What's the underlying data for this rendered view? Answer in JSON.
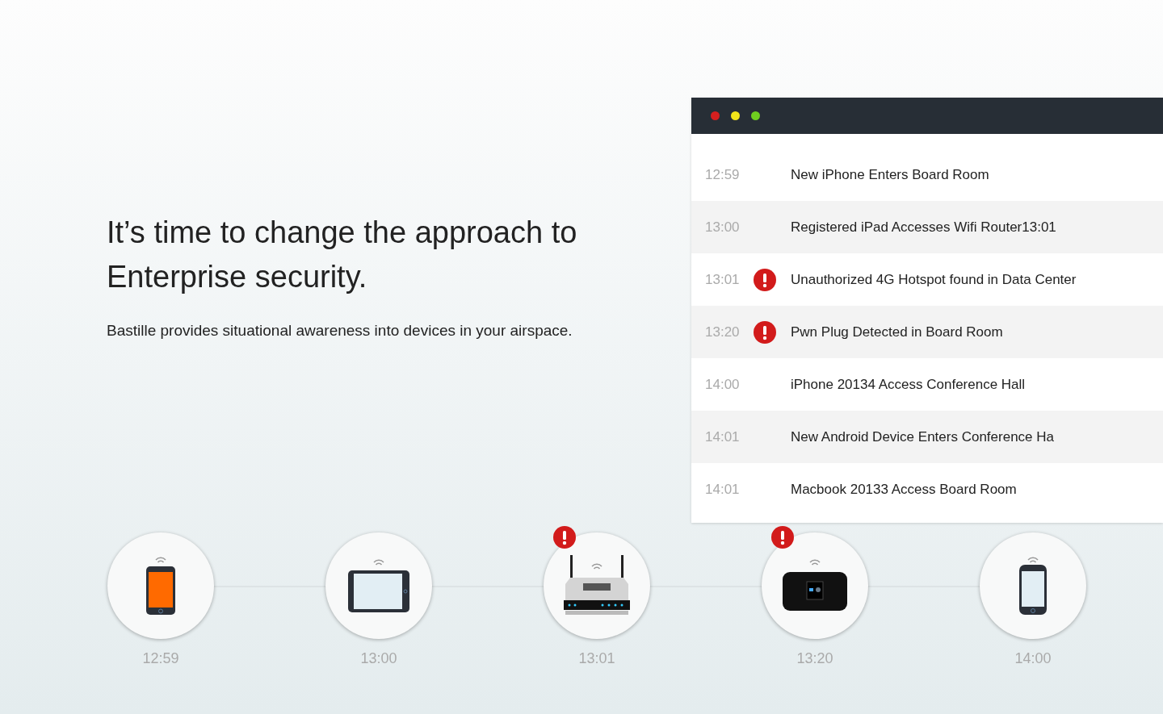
{
  "headline": "It’s time to change the approach to Enterprise security.",
  "subtitle": "Bastille provides situational awareness into devices in your airspace.",
  "window": {
    "controls": [
      {
        "color": "#d61f1f"
      },
      {
        "color": "#f2e51a"
      },
      {
        "color": "#6fcf1f"
      }
    ]
  },
  "events": [
    {
      "time": "12:59",
      "alert": false,
      "text": "New iPhone Enters Board Room"
    },
    {
      "time": "13:00",
      "alert": false,
      "text": "Registered iPad Accesses Wifi Router13:01"
    },
    {
      "time": "13:01",
      "alert": true,
      "text": "Unauthorized 4G Hotspot found in Data Center"
    },
    {
      "time": "13:20",
      "alert": true,
      "text": "Pwn Plug Detected in Board Room"
    },
    {
      "time": "14:00",
      "alert": false,
      "text": "iPhone 20134 Access Conference Hall"
    },
    {
      "time": "14:01",
      "alert": false,
      "text": "New Android Device Enters Conference Ha"
    },
    {
      "time": "14:01",
      "alert": false,
      "text": "Macbook 20133 Access Board Room"
    }
  ],
  "timeline": [
    {
      "kind": "phone",
      "alert": false,
      "time": "12:59"
    },
    {
      "kind": "tablet",
      "alert": false,
      "time": "13:00"
    },
    {
      "kind": "router",
      "alert": true,
      "time": "13:01"
    },
    {
      "kind": "hotspot",
      "alert": true,
      "time": "13:20"
    },
    {
      "kind": "smartphone",
      "alert": false,
      "time": "14:00"
    }
  ]
}
